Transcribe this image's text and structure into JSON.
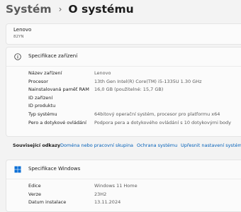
{
  "breadcrumb": {
    "parent": "Systém",
    "separator": "›",
    "current": "O systému"
  },
  "device": {
    "name": "Lenovo",
    "id": "82YN"
  },
  "device_specs": {
    "title": "Specifikace zařízení",
    "rows": [
      {
        "label": "Název zařízení",
        "value": "Lenovo"
      },
      {
        "label": "Procesor",
        "value": "13th Gen Intel(R) Core(TM) i5-1335U   1.30 GHz"
      },
      {
        "label": "Nainstalovaná paměť RAM",
        "value": "16,0 GB (použitelné: 15,7 GB)"
      },
      {
        "label": "ID zařízení",
        "value": ""
      },
      {
        "label": "ID produktu",
        "value": ""
      },
      {
        "label": "Typ systému",
        "value": "64bitový operační systém, procesor pro platformu x64"
      },
      {
        "label": "Pero a dotykové ovládání",
        "value": "Podpora pera a dotykového ovládání s 10 dotykovými body"
      }
    ]
  },
  "related": {
    "label": "Související odkazy",
    "links": [
      "Doména nebo pracovní skupina",
      "Ochrana systému",
      "Upřesnit nastavení systému"
    ]
  },
  "windows_specs": {
    "title": "Specifikace Windows",
    "rows": [
      {
        "label": "Edice",
        "value": "Windows 11 Home"
      },
      {
        "label": "Verze",
        "value": "23H2"
      },
      {
        "label": "Datum instalace",
        "value": "13.11.2024"
      }
    ]
  },
  "colors": {
    "accent": "#005fb8",
    "windows_logo": "#0a6fd6",
    "background": "#f3f3f3",
    "card": "#fbfbfb"
  },
  "icons": {
    "device_specs": "info-icon",
    "windows_specs": "windows-logo-icon"
  }
}
